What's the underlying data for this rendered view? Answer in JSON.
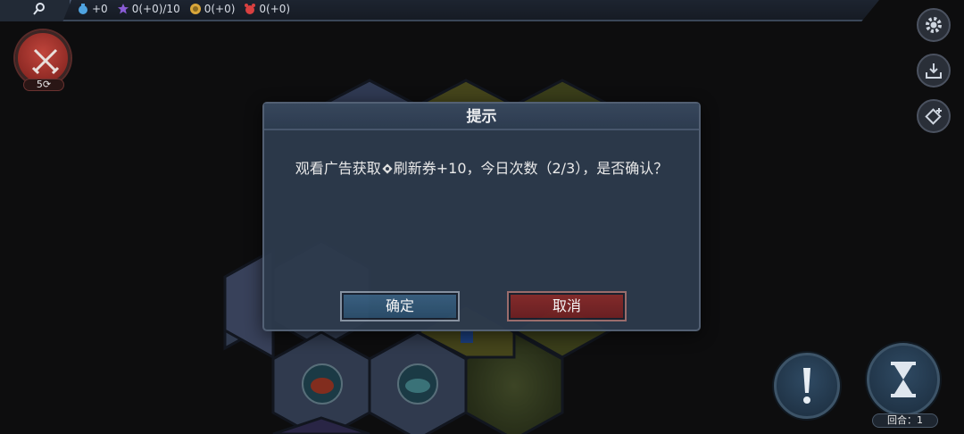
{
  "topbar": {
    "resources": [
      {
        "icon": "potion-icon",
        "value": "+0",
        "color": "#4fa3e0"
      },
      {
        "icon": "star-icon",
        "value": "0(+0)/10",
        "color": "#8a5cd6"
      },
      {
        "icon": "coin-icon",
        "value": "0(+0)",
        "color": "#d9a63a"
      },
      {
        "icon": "alarm-icon",
        "value": "0(+0)",
        "color": "#d84040"
      }
    ]
  },
  "battle": {
    "count": "5"
  },
  "round": {
    "label": "回合：1"
  },
  "dialog": {
    "title": "提示",
    "message_part1": "观看广告获取",
    "message_part2": "刷新券+10，今日次数（2/3），是否确认？",
    "confirm_label": "确定",
    "cancel_label": "取消"
  },
  "colors": {
    "dialog_bg": "#2d3a4c",
    "confirm_bg": "#2b4d6a",
    "cancel_bg": "#6b1f22"
  }
}
